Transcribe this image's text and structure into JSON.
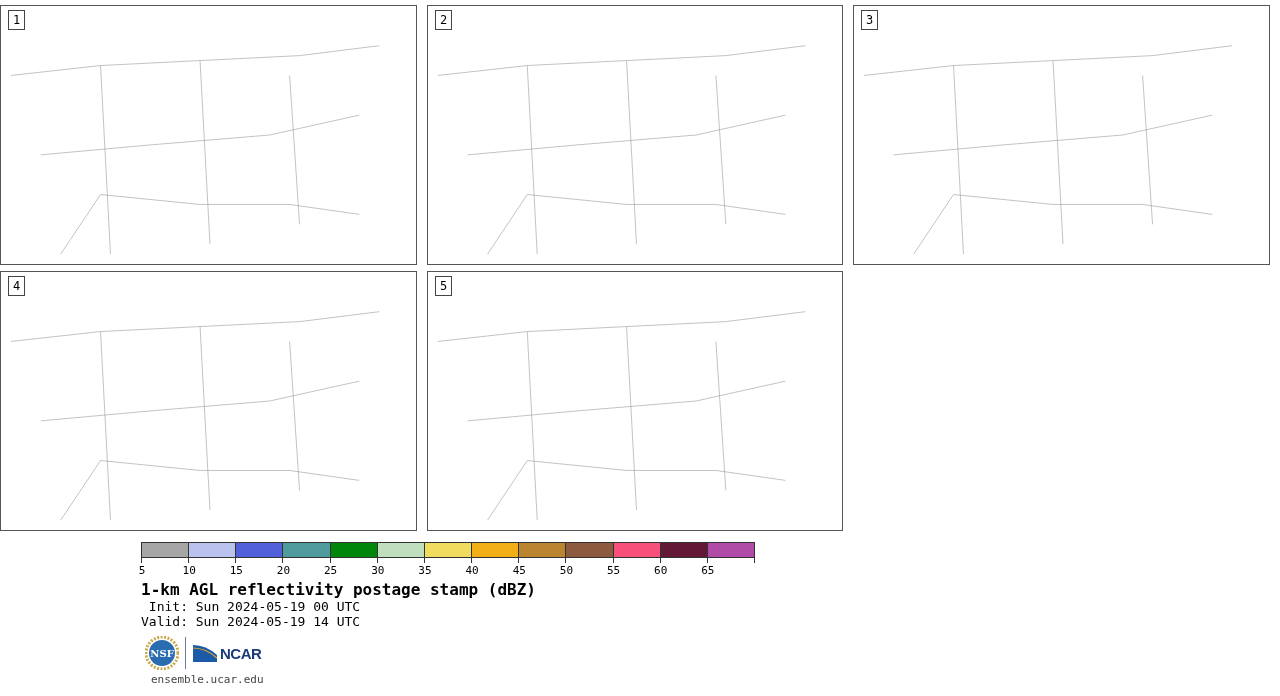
{
  "panels": [
    {
      "number": "1"
    },
    {
      "number": "2"
    },
    {
      "number": "3"
    },
    {
      "number": "4"
    },
    {
      "number": "5"
    }
  ],
  "colorbar": {
    "segments": [
      {
        "color": "#a6a6a6",
        "tick": "5"
      },
      {
        "color": "#b9c3ee",
        "tick": "10"
      },
      {
        "color": "#515fd8",
        "tick": "15"
      },
      {
        "color": "#4f9a9c",
        "tick": "20"
      },
      {
        "color": "#00860a",
        "tick": "25"
      },
      {
        "color": "#c0dfbe",
        "tick": "30"
      },
      {
        "color": "#f0dc5e",
        "tick": "35"
      },
      {
        "color": "#f1ae17",
        "tick": "40"
      },
      {
        "color": "#bb8430",
        "tick": "45"
      },
      {
        "color": "#8c5a3e",
        "tick": "50"
      },
      {
        "color": "#f6507b",
        "tick": "55"
      },
      {
        "color": "#631936",
        "tick": "60"
      },
      {
        "color": "#b04ca7",
        "tick": "65"
      }
    ]
  },
  "title": "1-km AGL reflectivity postage stamp (dBZ)",
  "init": " Init: Sun 2024-05-19 00 UTC",
  "valid": "Valid: Sun 2024-05-19 14 UTC",
  "logos": [
    {
      "text": "NSF"
    },
    {
      "text": "NCAR"
    }
  ],
  "url": "ensemble.ucar.edu"
}
